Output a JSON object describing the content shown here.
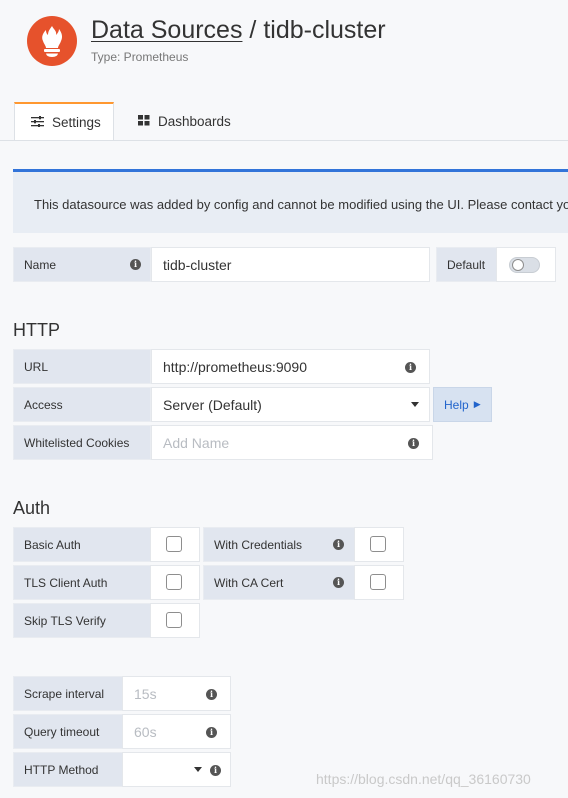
{
  "header": {
    "title_link": "Data Sources",
    "title_sep": "/",
    "title_name": "tidb-cluster",
    "subtitle": "Type: Prometheus"
  },
  "tabs": [
    {
      "label": "Settings",
      "icon": "sliders-icon",
      "active": true
    },
    {
      "label": "Dashboards",
      "icon": "apps-grid-icon",
      "active": false
    }
  ],
  "alert": {
    "text": "This datasource was added by config and cannot be modified using the UI. Please contact yo"
  },
  "name_row": {
    "label": "Name",
    "value": "tidb-cluster",
    "default_label": "Default",
    "default_on": false
  },
  "http": {
    "title": "HTTP",
    "url_label": "URL",
    "url_value": "http://prometheus:9090",
    "access_label": "Access",
    "access_value": "Server (Default)",
    "help_label": "Help",
    "cookies_label": "Whitelisted Cookies",
    "cookies_placeholder": "Add Name"
  },
  "auth": {
    "title": "Auth",
    "basic_auth": "Basic Auth",
    "with_credentials": "With Credentials",
    "tls_client_auth": "TLS Client Auth",
    "with_ca_cert": "With CA Cert",
    "skip_tls_verify": "Skip TLS Verify"
  },
  "prometheus": {
    "scrape_label": "Scrape interval",
    "scrape_placeholder": "15s",
    "query_label": "Query timeout",
    "query_placeholder": "60s",
    "method_label": "HTTP Method",
    "method_value": ""
  },
  "watermark": "https://blog.csdn.net/qq_36160730"
}
